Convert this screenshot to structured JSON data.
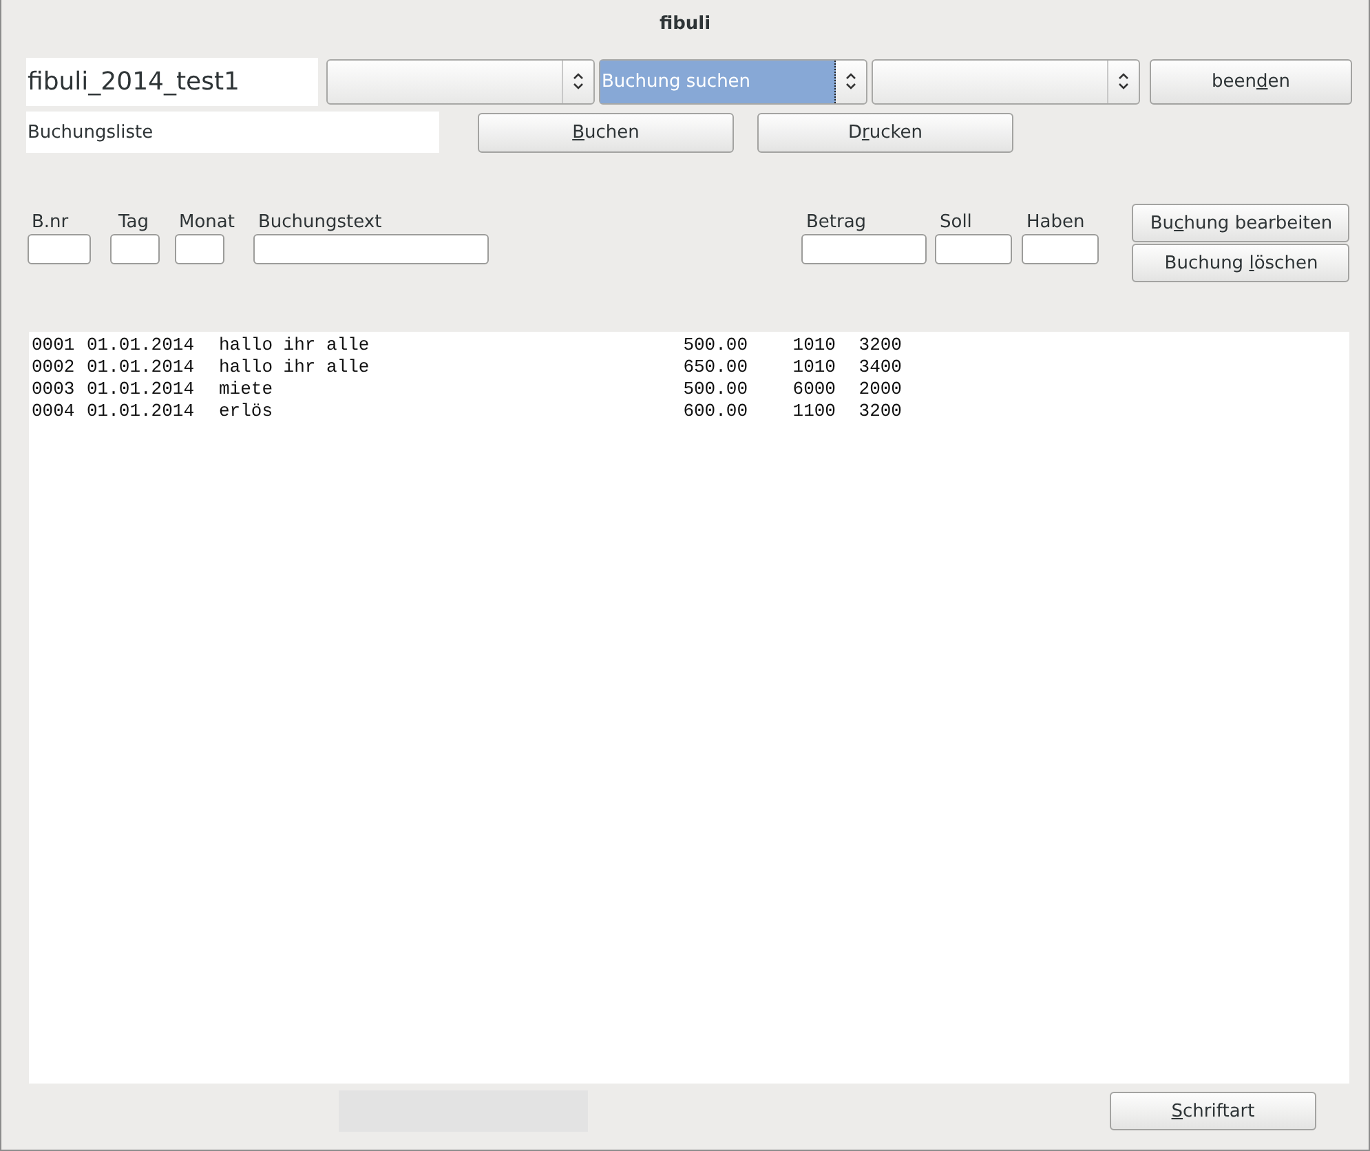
{
  "window": {
    "title": "fibuli"
  },
  "file_name": {
    "value": "fibuli_2014_test1"
  },
  "combos": [
    {
      "focused": false
    },
    {
      "value": "Buchung suchen",
      "focused": true
    },
    {
      "focused": false
    }
  ],
  "quit_button": {
    "before": "been",
    "key": "d",
    "after": "en"
  },
  "list_label": {
    "value": "Buchungsliste"
  },
  "action_buttons": [
    {
      "key": "B",
      "after": "uchen"
    },
    {
      "before": "D",
      "key": "r",
      "after": "ucken"
    }
  ],
  "entry_fields": [
    {
      "label": "B.nr"
    },
    {
      "label": "Tag"
    },
    {
      "label": "Monat"
    },
    {
      "label": "Buchungstext"
    },
    {
      "label": "Betrag"
    },
    {
      "label": "Soll"
    },
    {
      "label": "Haben"
    }
  ],
  "edit_buttons": [
    {
      "before": "Bu",
      "key": "c",
      "after": "hung bearbeiten"
    },
    {
      "before": "Buchung ",
      "key": "l",
      "after": "öschen"
    }
  ],
  "bookings": [
    {
      "nr": "0001",
      "date": "01.01.2014",
      "text": "hallo ihr alle",
      "amount": "500.00",
      "soll": "1010",
      "haben": "3200"
    },
    {
      "nr": "0002",
      "date": "01.01.2014",
      "text": "hallo ihr alle",
      "amount": "650.00",
      "soll": "1010",
      "haben": "3400"
    },
    {
      "nr": "0003",
      "date": "01.01.2014",
      "text": "miete",
      "amount": "500.00",
      "soll": "6000",
      "haben": "2000"
    },
    {
      "nr": "0004",
      "date": "01.01.2014",
      "text": "erlös",
      "amount": "600.00",
      "soll": "1100",
      "haben": "3200"
    }
  ],
  "progress": {
    "level": 0
  },
  "font_button": {
    "key": "S",
    "after": "chriftart"
  }
}
